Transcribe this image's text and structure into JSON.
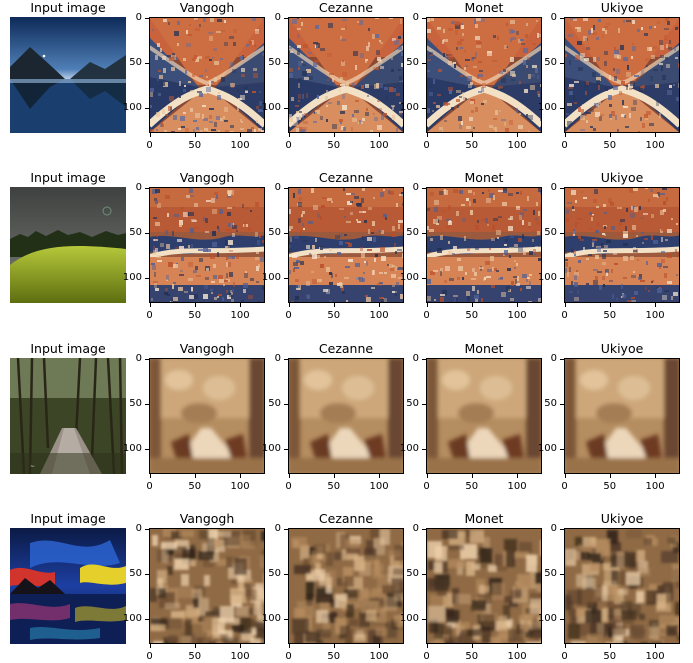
{
  "rows": [
    {
      "input_title": "Input image",
      "input_scene": "lake-mountains-dusk",
      "outputs": [
        {
          "title": "Vangogh",
          "style": "fire-x"
        },
        {
          "title": "Cezanne",
          "style": "fire-x"
        },
        {
          "title": "Monet",
          "style": "fire-x"
        },
        {
          "title": "Ukiyoe",
          "style": "fire-x"
        }
      ]
    },
    {
      "input_title": "Input image",
      "input_scene": "green-hill-grey-sky",
      "outputs": [
        {
          "title": "Vangogh",
          "style": "fire-band"
        },
        {
          "title": "Cezanne",
          "style": "fire-band"
        },
        {
          "title": "Monet",
          "style": "fire-band"
        },
        {
          "title": "Ukiyoe",
          "style": "fire-band"
        }
      ]
    },
    {
      "input_title": "Input image",
      "input_scene": "forest-boardwalk",
      "outputs": [
        {
          "title": "Vangogh",
          "style": "beige-path"
        },
        {
          "title": "Cezanne",
          "style": "beige-path"
        },
        {
          "title": "Monet",
          "style": "beige-path"
        },
        {
          "title": "Ukiyoe",
          "style": "beige-path"
        }
      ]
    },
    {
      "input_title": "Input image",
      "input_scene": "neon-night-sky",
      "outputs": [
        {
          "title": "Vangogh",
          "style": "brown-mottle"
        },
        {
          "title": "Cezanne",
          "style": "brown-mottle"
        },
        {
          "title": "Monet",
          "style": "brown-mottle"
        },
        {
          "title": "Ukiyoe",
          "style": "brown-mottle"
        }
      ]
    }
  ],
  "axis": {
    "y_ticks": [
      "0",
      "50",
      "100"
    ],
    "x_ticks": [
      "0",
      "50",
      "100"
    ],
    "y_tick_values": [
      0,
      50,
      100
    ],
    "x_tick_values": [
      0,
      50,
      100
    ],
    "image_size": 128
  },
  "colors": {
    "fire": "#c9683a",
    "cream": "#f1dcc2",
    "navy": "#2c3a6a",
    "beige": "#c9a577",
    "dark_brown": "#5a3320"
  }
}
